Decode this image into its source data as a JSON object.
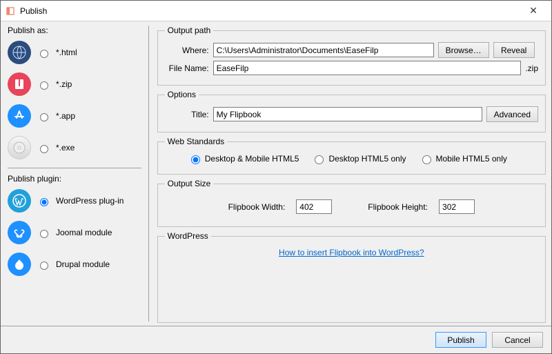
{
  "title": "Publish",
  "left": {
    "publish_as_label": "Publish as:",
    "formats": [
      {
        "key": "html",
        "label": "*.html",
        "checked": false
      },
      {
        "key": "zip",
        "label": "*.zip",
        "checked": false
      },
      {
        "key": "app",
        "label": "*.app",
        "checked": false
      },
      {
        "key": "exe",
        "label": "*.exe",
        "checked": false
      }
    ],
    "publish_plugin_label": "Publish plugin:",
    "plugins": [
      {
        "key": "wordpress",
        "label": "WordPress plug-in",
        "checked": true
      },
      {
        "key": "joomla",
        "label": "Joomal module",
        "checked": false
      },
      {
        "key": "drupal",
        "label": "Drupal module",
        "checked": false
      }
    ]
  },
  "output_path": {
    "legend": "Output path",
    "where_label": "Where:",
    "where_value": "C:\\Users\\Administrator\\Documents\\EaseFilp",
    "browse": "Browse…",
    "reveal": "Reveal",
    "filename_label": "File Name:",
    "filename_value": "EaseFilp",
    "ext": ".zip"
  },
  "options": {
    "legend": "Options",
    "title_label": "Title:",
    "title_value": "My Flipbook",
    "advanced": "Advanced"
  },
  "web_standards": {
    "legend": "Web Standards",
    "options": [
      {
        "label": "Desktop & Mobile HTML5",
        "checked": true
      },
      {
        "label": "Desktop HTML5 only",
        "checked": false
      },
      {
        "label": "Mobile HTML5 only",
        "checked": false
      }
    ]
  },
  "output_size": {
    "legend": "Output Size",
    "width_label": "Flipbook Width:",
    "width_value": "402",
    "height_label": "Flipbook Height:",
    "height_value": "302"
  },
  "wordpress_section": {
    "legend": "WordPress",
    "link": "How to insert Flipbook into WordPress?"
  },
  "footer": {
    "publish": "Publish",
    "cancel": "Cancel"
  },
  "icons": {}
}
